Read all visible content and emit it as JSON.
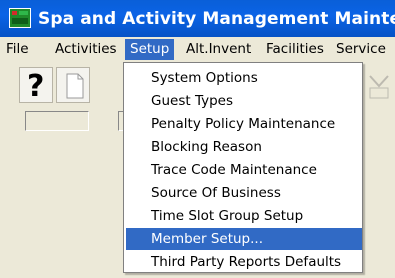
{
  "window": {
    "title": "Spa and Activity Management Maintenance"
  },
  "menubar": {
    "items": [
      {
        "label": "File",
        "active": false
      },
      {
        "label": "Activities",
        "active": false
      },
      {
        "label": "Setup",
        "active": true
      },
      {
        "label": "Alt.Invent",
        "active": false
      },
      {
        "label": "Facilities",
        "active": false
      },
      {
        "label": "Service",
        "active": false
      }
    ]
  },
  "toolbar": {
    "help_icon": "question-mark-icon",
    "help_glyph": "?",
    "new_icon": "document-icon"
  },
  "setup_menu": {
    "items": [
      {
        "label": "System Options"
      },
      {
        "label": "Guest Types"
      },
      {
        "label": "Penalty Policy Maintenance"
      },
      {
        "label": "Blocking Reason"
      },
      {
        "label": "Trace Code Maintenance"
      },
      {
        "label": "Source Of Business"
      },
      {
        "label": "Time Slot Group Setup"
      },
      {
        "label": "Member Setup..."
      },
      {
        "label": "Third Party Reports Defaults"
      }
    ],
    "selected_label": "Member Setup..."
  },
  "colors": {
    "title_bar": "#0b63e6",
    "highlight": "#316ac5",
    "menu_bg": "#ece9d8"
  }
}
